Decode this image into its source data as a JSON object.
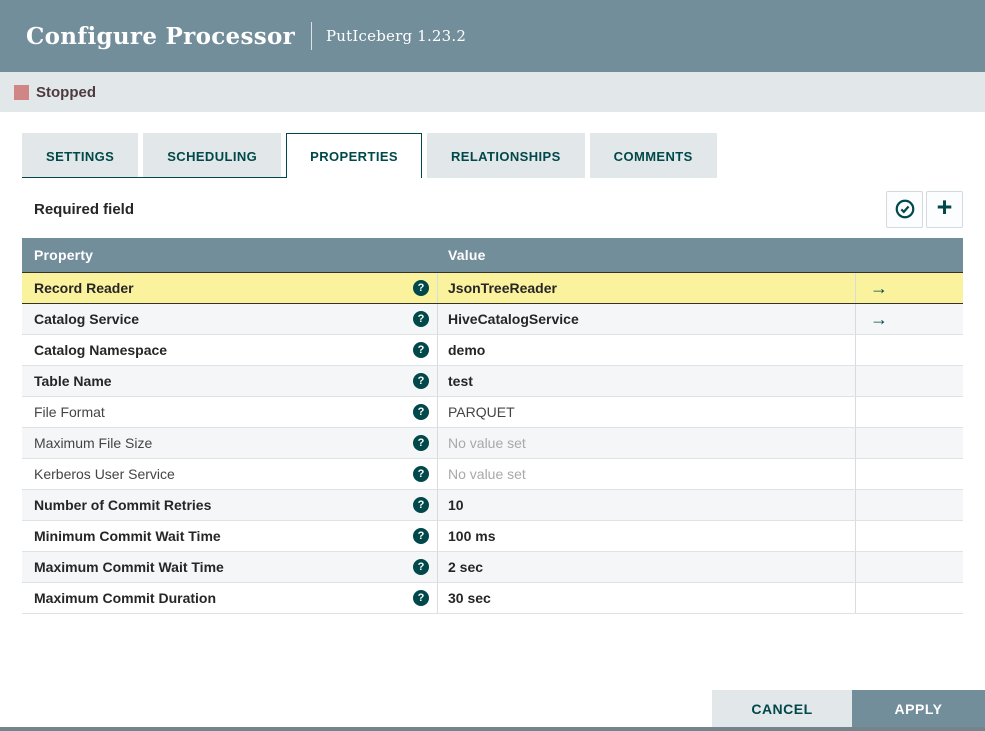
{
  "dialog": {
    "title": "Configure Processor",
    "subtitle": "PutIceberg 1.23.2",
    "status": {
      "label": "Stopped",
      "state_color": "#D18686"
    },
    "tabs": [
      {
        "label": "SETTINGS",
        "active": false
      },
      {
        "label": "SCHEDULING",
        "active": false
      },
      {
        "label": "PROPERTIES",
        "active": true
      },
      {
        "label": "RELATIONSHIPS",
        "active": false
      },
      {
        "label": "COMMENTS",
        "active": false
      }
    ],
    "properties_panel": {
      "required_field_label": "Required field",
      "icons": {
        "help": "?",
        "go_to": "→",
        "add": "+"
      },
      "table": {
        "columns": [
          "Property",
          "Value"
        ],
        "rows": [
          {
            "property": "Record Reader",
            "value": "JsonTreeReader",
            "bold": true,
            "unset": false,
            "has_arrow": true,
            "selected": true
          },
          {
            "property": "Catalog Service",
            "value": "HiveCatalogService",
            "bold": true,
            "unset": false,
            "has_arrow": true,
            "selected": false
          },
          {
            "property": "Catalog Namespace",
            "value": "demo",
            "bold": true,
            "unset": false,
            "has_arrow": false,
            "selected": false
          },
          {
            "property": "Table Name",
            "value": "test",
            "bold": true,
            "unset": false,
            "has_arrow": false,
            "selected": false
          },
          {
            "property": "File Format",
            "value": "PARQUET",
            "bold": false,
            "unset": false,
            "has_arrow": false,
            "selected": false
          },
          {
            "property": "Maximum File Size",
            "value": "No value set",
            "bold": false,
            "unset": true,
            "has_arrow": false,
            "selected": false
          },
          {
            "property": "Kerberos User Service",
            "value": "No value set",
            "bold": false,
            "unset": true,
            "has_arrow": false,
            "selected": false
          },
          {
            "property": "Number of Commit Retries",
            "value": "10",
            "bold": true,
            "unset": false,
            "has_arrow": false,
            "selected": false
          },
          {
            "property": "Minimum Commit Wait Time",
            "value": "100 ms",
            "bold": true,
            "unset": false,
            "has_arrow": false,
            "selected": false
          },
          {
            "property": "Maximum Commit Wait Time",
            "value": "2 sec",
            "bold": true,
            "unset": false,
            "has_arrow": false,
            "selected": false
          },
          {
            "property": "Maximum Commit Duration",
            "value": "30 sec",
            "bold": true,
            "unset": false,
            "has_arrow": false,
            "selected": false
          }
        ]
      }
    },
    "footer": {
      "cancel_label": "CANCEL",
      "apply_label": "APPLY"
    },
    "colors": {
      "accent_teal": "#004849",
      "header_slate": "#728E9B",
      "statusbar_bg": "#E2E7EA",
      "stopped_red": "#D18686",
      "selected_row_yellow": "#FAF29D",
      "alt_row_bg": "#F4F6F7"
    }
  }
}
